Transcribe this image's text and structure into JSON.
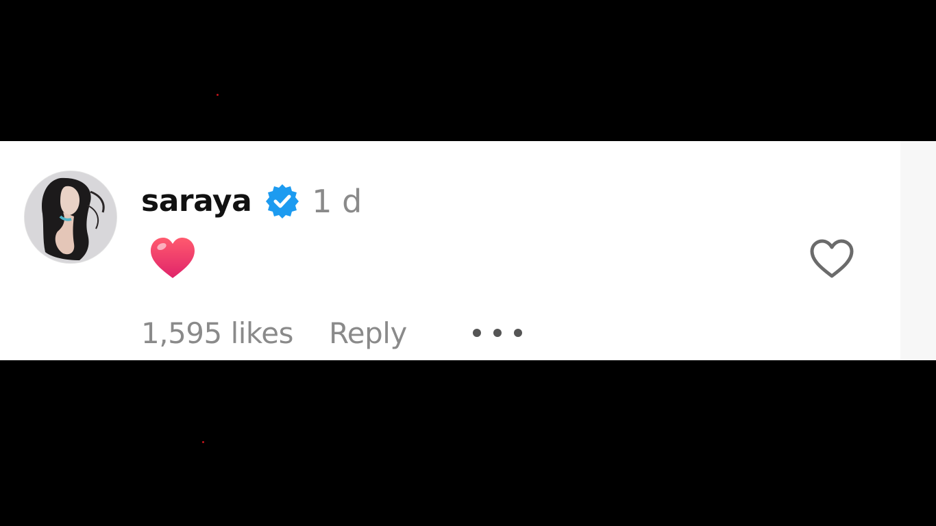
{
  "comment": {
    "username": "saraya",
    "verified": true,
    "timestamp": "1 d",
    "body_emoji": "heart-emoji",
    "likes_label": "1,595 likes",
    "reply_label": "Reply",
    "more_icon": "more-options-icon",
    "like_icon": "heart-outline-icon"
  },
  "colors": {
    "background": "#000000",
    "card": "#ffffff",
    "username": "#111111",
    "secondary_text": "#8a8a8a",
    "verified_badge": "#1d9bf0",
    "heart_emoji": "#f0386b"
  }
}
